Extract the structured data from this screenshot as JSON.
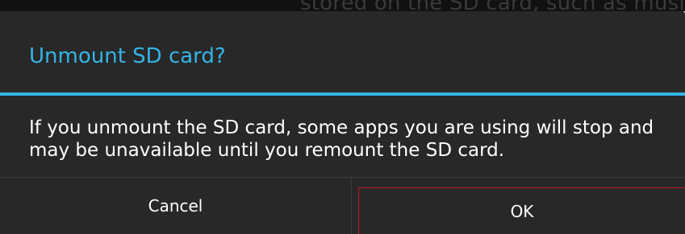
{
  "background": {
    "partial_text": "stored on the SD card, such as music or"
  },
  "dialog": {
    "title": "Unmount SD card?",
    "message": "If you unmount the SD card, some apps you are using will stop and may be unavailable until you remount the SD card.",
    "buttons": {
      "cancel_label": "Cancel",
      "ok_label": "OK"
    }
  },
  "colors": {
    "accent": "#33b5e5",
    "dialog_background": "#282828",
    "focus_outline": "#b81e1e"
  }
}
